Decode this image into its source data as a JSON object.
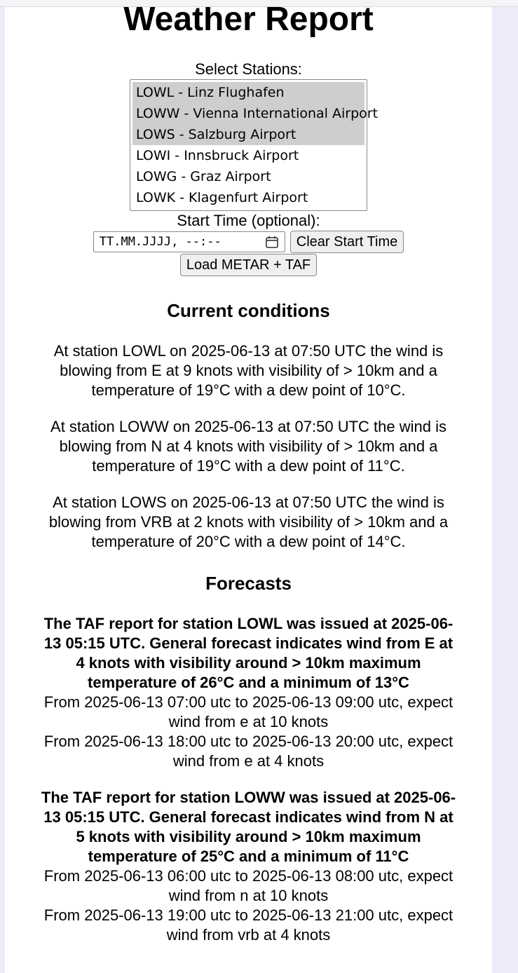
{
  "header": {
    "title": "Weather Report"
  },
  "stations": {
    "label": "Select Stations:",
    "options": [
      {
        "label": "LOWL - Linz Flughafen",
        "selected": true
      },
      {
        "label": "LOWW - Vienna International Airport",
        "selected": true
      },
      {
        "label": "LOWS - Salzburg Airport",
        "selected": true
      },
      {
        "label": "LOWI - Innsbruck Airport",
        "selected": false
      },
      {
        "label": "LOWG - Graz Airport",
        "selected": false
      },
      {
        "label": "LOWK - Klagenfurt Airport",
        "selected": false
      }
    ]
  },
  "start_time": {
    "label": "Start Time (optional):",
    "placeholder": "TT.MM.JJJJ, --:--",
    "calendar_icon": "calendar-icon",
    "clear_button": "Clear Start Time"
  },
  "load_button": "Load METAR + TAF",
  "current": {
    "heading": "Current conditions",
    "observations": [
      "At station LOWL on 2025-06-13 at 07:50 UTC the wind is blowing from E at 9 knots with visibility of > 10km and a temperature of 19°C with a dew point of 10°C.",
      "At station LOWW on 2025-06-13 at 07:50 UTC the wind is blowing from N at 4 knots with visibility of > 10km and a temperature of 19°C with a dew point of 11°C.",
      "At station LOWS on 2025-06-13 at 07:50 UTC the wind is blowing from VRB at 2 knots with visibility of > 10km and a temperature of 20°C with a dew point of 14°C."
    ]
  },
  "forecasts": {
    "heading": "Forecasts",
    "reports": [
      {
        "summary": "The TAF report for station LOWL was issued at 2025-06-13 05:15 UTC. General forecast indicates wind from E at 4 knots with visibility around > 10km maximum temperature of 26°C and a minimum of 13°C",
        "periods": [
          "From 2025-06-13 07:00 utc to 2025-06-13 09:00 utc, expect wind from e at 10 knots",
          "From 2025-06-13 18:00 utc to 2025-06-13 20:00 utc, expect wind from e at 4 knots"
        ]
      },
      {
        "summary": "The TAF report for station LOWW was issued at 2025-06-13 05:15 UTC. General forecast indicates wind from N at 5 knots with visibility around > 10km maximum temperature of 25°C and a minimum of 11°C",
        "periods": [
          "From 2025-06-13 06:00 utc to 2025-06-13 08:00 utc, expect wind from n at 10 knots",
          "From 2025-06-13 19:00 utc to 2025-06-13 21:00 utc, expect wind from vrb at 4 knots"
        ]
      }
    ]
  }
}
